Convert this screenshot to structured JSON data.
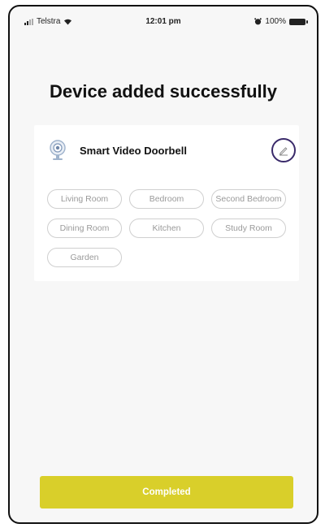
{
  "status_bar": {
    "carrier": "Telstra",
    "time": "12:01 pm",
    "battery_percent": "100%"
  },
  "page": {
    "title": "Device added successfully"
  },
  "device": {
    "name": "Smart Video Doorbell",
    "icon": "camera-icon",
    "edit_icon": "pencil-icon"
  },
  "rooms": [
    "Living Room",
    "Bedroom",
    "Second Bedroom",
    "Dining Room",
    "Kitchen",
    "Study Room",
    "Garden"
  ],
  "actions": {
    "completed_label": "Completed"
  },
  "colors": {
    "background": "#f7f7f7",
    "card": "#ffffff",
    "primary_button": "#d9cf2a",
    "edit_ring": "#3a2a6a",
    "chip_border": "#cfcfcf",
    "chip_text": "#9a9a9a"
  }
}
